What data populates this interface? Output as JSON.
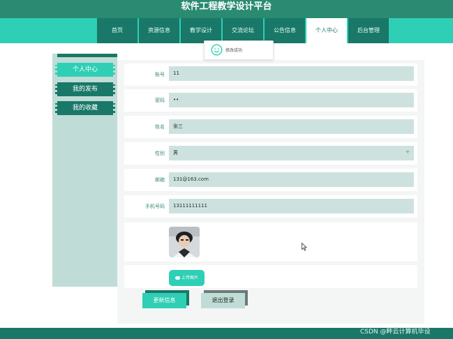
{
  "header": {
    "title": "软件工程教学设计平台"
  },
  "nav": {
    "items": [
      {
        "label": "首页"
      },
      {
        "label": "资源信息"
      },
      {
        "label": "教学设计"
      },
      {
        "label": "交流论坛"
      },
      {
        "label": "公告信息"
      },
      {
        "label": "个人中心"
      },
      {
        "label": "后台管理"
      }
    ],
    "active_index": 5
  },
  "sidebar": {
    "items": [
      {
        "label": "个人中心"
      },
      {
        "label": "我的发布"
      },
      {
        "label": "我的收藏"
      }
    ]
  },
  "toast": {
    "message": "修改成功",
    "icon": "smile-icon"
  },
  "form": {
    "account": {
      "label": "账号",
      "value": "11"
    },
    "password": {
      "label": "密码",
      "value": "••"
    },
    "name": {
      "label": "姓名",
      "value": "张三"
    },
    "gender": {
      "label": "性别",
      "value": "男"
    },
    "email": {
      "label": "邮箱",
      "value": "131@163.com"
    },
    "phone": {
      "label": "手机号码",
      "value": "13111111111"
    },
    "upload_label": "上传图片",
    "update_button": "更新信息",
    "logout_button": "退出登录"
  },
  "footer": {
    "watermark": "CSDN @畔云计算机毕设"
  },
  "colors": {
    "header_dark": "#197868",
    "accent": "#2fcfb5",
    "input_bg": "#cde2de",
    "sidebar_bg": "#c0dcd6"
  }
}
